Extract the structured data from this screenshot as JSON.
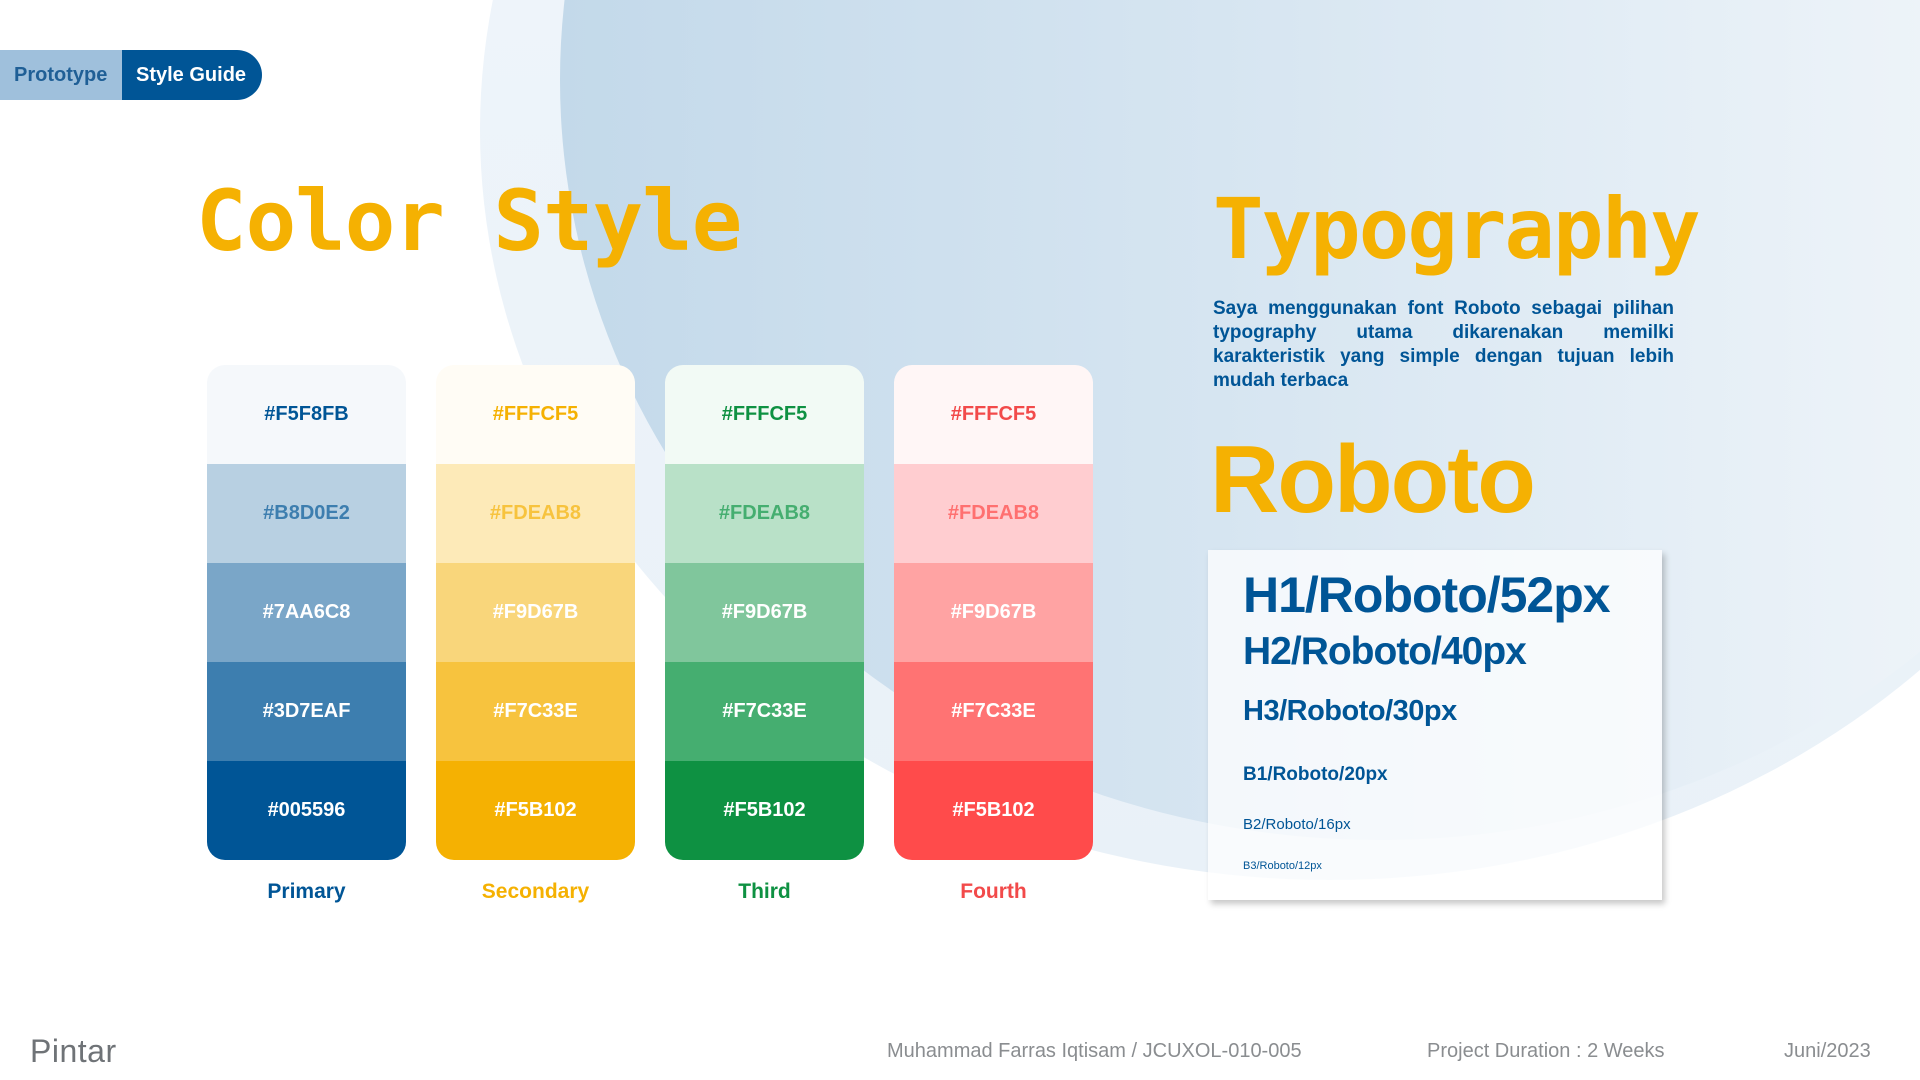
{
  "tabs": [
    {
      "label": "Prototype",
      "active": false
    },
    {
      "label": "Style Guide",
      "active": true
    }
  ],
  "color_style": {
    "title": "Color Style",
    "palettes": [
      {
        "name": "Primary",
        "label_color": "#005596",
        "swatches": [
          {
            "hex_label": "#F5F8FB",
            "fill": "#F5F8FB",
            "text_color": "#005596"
          },
          {
            "hex_label": "#B8D0E2",
            "fill": "#B8D0E2",
            "text_color": "#3D7EAF"
          },
          {
            "hex_label": "#7AA6C8",
            "fill": "#7AA6C8",
            "text_color": "#FFFFFF"
          },
          {
            "hex_label": "#3D7EAF",
            "fill": "#3D7EAF",
            "text_color": "#FFFFFF"
          },
          {
            "hex_label": "#005596",
            "fill": "#005596",
            "text_color": "#FFFFFF"
          }
        ]
      },
      {
        "name": "Secondary",
        "label_color": "#F5B102",
        "swatches": [
          {
            "hex_label": "#FFFCF5",
            "fill": "#FFFCF5",
            "text_color": "#F5B102"
          },
          {
            "hex_label": "#FDEAB8",
            "fill": "#FDEAB8",
            "text_color": "#F7C33E"
          },
          {
            "hex_label": "#F9D67B",
            "fill": "#F9D67B",
            "text_color": "#FFFFFF"
          },
          {
            "hex_label": "#F7C33E",
            "fill": "#F7C33E",
            "text_color": "#FFFFFF"
          },
          {
            "hex_label": "#F5B102",
            "fill": "#F5B102",
            "text_color": "#FFFFFF"
          }
        ]
      },
      {
        "name": "Third",
        "label_color": "#0E9142",
        "swatches": [
          {
            "hex_label": "#FFFCF5",
            "fill": "#F2FAF5",
            "text_color": "#0E9142"
          },
          {
            "hex_label": "#FDEAB8",
            "fill": "#B9E1C8",
            "text_color": "#45AE70"
          },
          {
            "hex_label": "#F9D67B",
            "fill": "#80C69C",
            "text_color": "#FFFFFF"
          },
          {
            "hex_label": "#F7C33E",
            "fill": "#45AE70",
            "text_color": "#FFFFFF"
          },
          {
            "hex_label": "#F5B102",
            "fill": "#0E9142",
            "text_color": "#FFFFFF"
          }
        ]
      },
      {
        "name": "Fourth",
        "label_color": "#F24A4A",
        "swatches": [
          {
            "hex_label": "#FFFCF5",
            "fill": "#FFF6F6",
            "text_color": "#F24A4A"
          },
          {
            "hex_label": "#FDEAB8",
            "fill": "#FFCDD0",
            "text_color": "#FF7070"
          },
          {
            "hex_label": "#F9D67B",
            "fill": "#FFA3A3",
            "text_color": "#FFFFFF"
          },
          {
            "hex_label": "#F7C33E",
            "fill": "#FF7373",
            "text_color": "#FFFFFF"
          },
          {
            "hex_label": "#F5B102",
            "fill": "#FF4B4B",
            "text_color": "#FFFFFF"
          }
        ]
      }
    ]
  },
  "typography": {
    "title": "Typography",
    "description": "Saya menggunakan font Roboto sebagai pilihan typography utama dikarenakan memilki karakteristik yang simple dengan tujuan lebih mudah terbaca",
    "font_name": "Roboto",
    "samples": {
      "h1": "H1/Roboto/52px",
      "h2": "H2/Roboto/40px",
      "h3": "H3/Roboto/30px",
      "b1": "B1/Roboto/20px",
      "b2": "B2/Roboto/16px",
      "b3": "B3/Roboto/12px"
    }
  },
  "footer": {
    "logo": "Pintar",
    "author": "Muhammad Farras Iqtisam / JCUXOL-010-005",
    "duration": "Project Duration : 2 Weeks",
    "date": "Juni/2023"
  },
  "colors": {
    "brand_blue": "#005596",
    "accent_yellow": "#F5B102"
  }
}
